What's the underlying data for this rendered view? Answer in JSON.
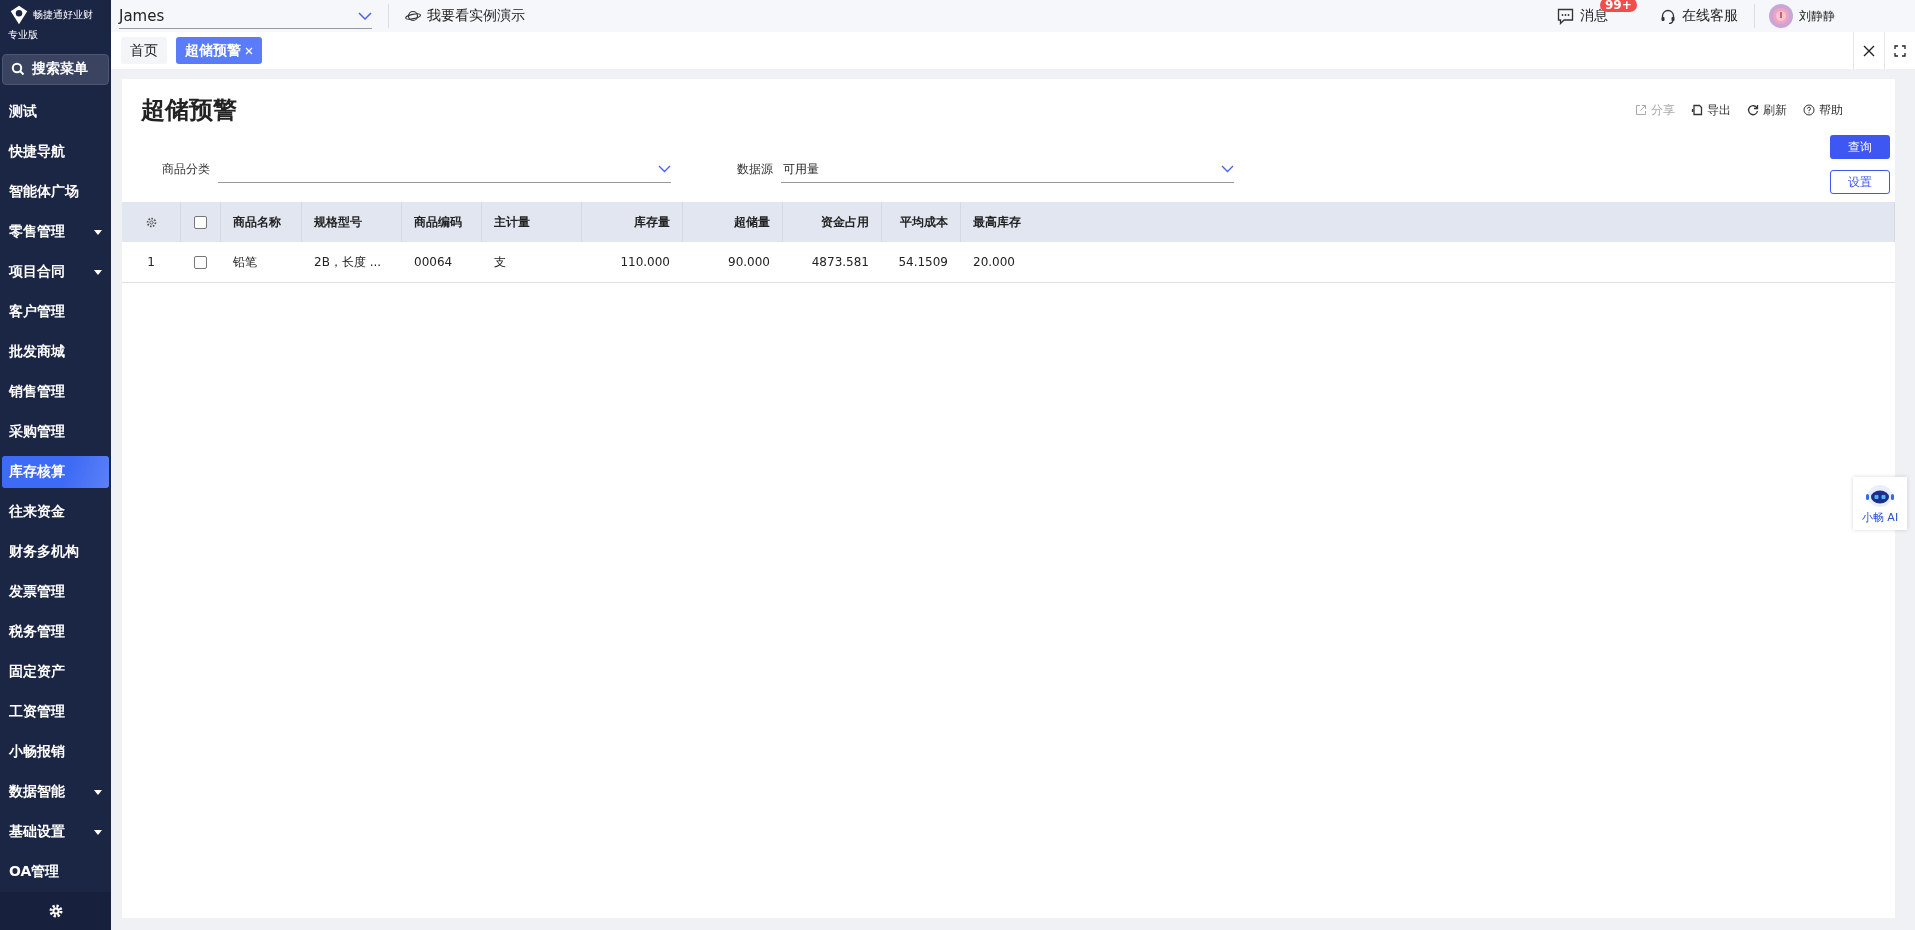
{
  "brand": {
    "name": "畅捷通好业财",
    "edition": "专业版"
  },
  "sidebar": {
    "search": "搜索菜单",
    "items": [
      {
        "label": "测试",
        "has_submenu": false,
        "selected": false
      },
      {
        "label": "快捷导航",
        "has_submenu": false,
        "selected": false
      },
      {
        "label": "智能体广场",
        "has_submenu": false,
        "selected": false
      },
      {
        "label": "零售管理",
        "has_submenu": true,
        "selected": false
      },
      {
        "label": "项目合同",
        "has_submenu": true,
        "selected": false
      },
      {
        "label": "客户管理",
        "has_submenu": false,
        "selected": false
      },
      {
        "label": "批发商城",
        "has_submenu": false,
        "selected": false
      },
      {
        "label": "销售管理",
        "has_submenu": false,
        "selected": false
      },
      {
        "label": "采购管理",
        "has_submenu": false,
        "selected": false
      },
      {
        "label": "库存核算",
        "has_submenu": false,
        "selected": true
      },
      {
        "label": "往来资金",
        "has_submenu": false,
        "selected": false
      },
      {
        "label": "财务多机构",
        "has_submenu": false,
        "selected": false
      },
      {
        "label": "发票管理",
        "has_submenu": false,
        "selected": false
      },
      {
        "label": "税务管理",
        "has_submenu": false,
        "selected": false
      },
      {
        "label": "固定资产",
        "has_submenu": false,
        "selected": false
      },
      {
        "label": "工资管理",
        "has_submenu": false,
        "selected": false
      },
      {
        "label": "小畅报销",
        "has_submenu": false,
        "selected": false
      },
      {
        "label": "数据智能",
        "has_submenu": true,
        "selected": false
      },
      {
        "label": "基础设置",
        "has_submenu": true,
        "selected": false
      },
      {
        "label": "OA管理",
        "has_submenu": false,
        "selected": false
      }
    ]
  },
  "topbar": {
    "account": "James",
    "demo": "我要看实例演示",
    "messages": "消息",
    "badge": "99+",
    "service": "在线客服",
    "user": "刘静静"
  },
  "tabs": [
    {
      "label": "首页",
      "selected": false,
      "closable": false
    },
    {
      "label": "超储预警",
      "selected": true,
      "closable": true
    }
  ],
  "page": {
    "title": "超储预警",
    "actions": [
      {
        "label": "分享",
        "disabled": true
      },
      {
        "label": "导出",
        "disabled": false
      },
      {
        "label": "刷新",
        "disabled": false
      },
      {
        "label": "帮助",
        "disabled": false
      }
    ],
    "filters": [
      {
        "label": "商品分类"
      },
      {
        "label": "数据源",
        "value": "可用量"
      }
    ],
    "buttons": [
      {
        "label": "查询",
        "kind": "primary"
      },
      {
        "label": "设置",
        "kind": "outline"
      }
    ]
  },
  "table": {
    "header_checked": false,
    "columns": [
      {
        "label": "商品名称",
        "kind": "text"
      },
      {
        "label": "规格型号",
        "kind": "text"
      },
      {
        "label": "商品编码",
        "kind": "text"
      },
      {
        "label": "主计量",
        "kind": "text"
      },
      {
        "label": "库存量",
        "kind": "number"
      },
      {
        "label": "超储量",
        "kind": "number"
      },
      {
        "label": "资金占用",
        "kind": "number"
      },
      {
        "label": "平均成本",
        "kind": "number"
      },
      {
        "label": "最高库存",
        "kind": "text"
      }
    ],
    "rows": [
      {
        "index": "1",
        "checked": false,
        "cells": [
          "铅笔",
          "2B，长度 ...",
          "00064",
          "支",
          "110.000",
          "90.000",
          "4873.581",
          "54.1509",
          "20.000"
        ]
      }
    ]
  },
  "assistant": {
    "label": "小畅 AI"
  }
}
